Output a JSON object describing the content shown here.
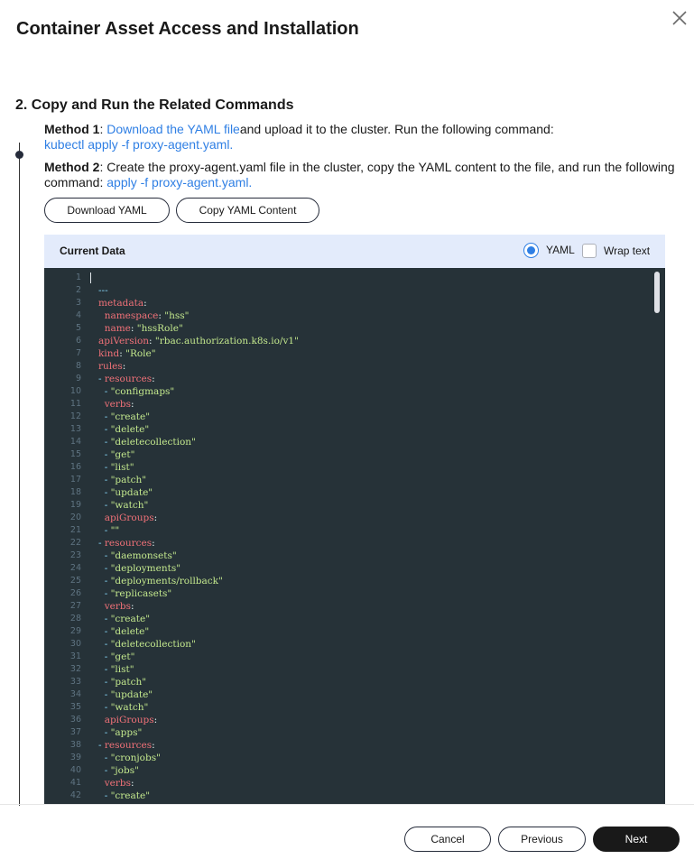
{
  "dialog": {
    "title": "Container Asset Access and Installation",
    "close_icon": "close-icon"
  },
  "section": {
    "title": "2. Copy and Run the Related Commands"
  },
  "method1": {
    "label": "Method 1",
    "sep": ": ",
    "link": "Download the YAML file",
    "text": "and upload it to the cluster. Run the following command:",
    "command": "kubectl apply -f proxy-agent.yaml."
  },
  "method2": {
    "label": "Method 2",
    "text": ": Create the proxy-agent.yaml file in the cluster, copy the YAML content to the file, and run the following command: ",
    "command": "apply -f proxy-agent.yaml."
  },
  "buttons": {
    "download_yaml": "Download YAML",
    "copy_yaml": "Copy YAML Content"
  },
  "data_panel": {
    "title": "Current Data",
    "radio_label": "YAML",
    "radio_selected": true,
    "checkbox_label": "Wrap text",
    "checkbox_checked": false
  },
  "code_lines": [
    [
      [
        "p",
        ""
      ]
    ],
    [
      [
        "d",
        "---"
      ]
    ],
    [
      [
        "k",
        "metadata"
      ],
      [
        "p",
        ":"
      ]
    ],
    [
      [
        "p",
        "  "
      ],
      [
        "k",
        "namespace"
      ],
      [
        "p",
        ": "
      ],
      [
        "s",
        "\"hss\""
      ]
    ],
    [
      [
        "p",
        "  "
      ],
      [
        "k",
        "name"
      ],
      [
        "p",
        ": "
      ],
      [
        "s",
        "\"hssRole\""
      ]
    ],
    [
      [
        "k",
        "apiVersion"
      ],
      [
        "p",
        ": "
      ],
      [
        "s",
        "\"rbac.authorization.k8s.io/v1\""
      ]
    ],
    [
      [
        "k",
        "kind"
      ],
      [
        "p",
        ": "
      ],
      [
        "s",
        "\"Role\""
      ]
    ],
    [
      [
        "k",
        "rules"
      ],
      [
        "p",
        ":"
      ]
    ],
    [
      [
        "d",
        "- "
      ],
      [
        "k",
        "resources"
      ],
      [
        "p",
        ":"
      ]
    ],
    [
      [
        "p",
        "  "
      ],
      [
        "d",
        "- "
      ],
      [
        "s",
        "\"configmaps\""
      ]
    ],
    [
      [
        "p",
        "  "
      ],
      [
        "k",
        "verbs"
      ],
      [
        "p",
        ":"
      ]
    ],
    [
      [
        "p",
        "  "
      ],
      [
        "d",
        "- "
      ],
      [
        "s",
        "\"create\""
      ]
    ],
    [
      [
        "p",
        "  "
      ],
      [
        "d",
        "- "
      ],
      [
        "s",
        "\"delete\""
      ]
    ],
    [
      [
        "p",
        "  "
      ],
      [
        "d",
        "- "
      ],
      [
        "s",
        "\"deletecollection\""
      ]
    ],
    [
      [
        "p",
        "  "
      ],
      [
        "d",
        "- "
      ],
      [
        "s",
        "\"get\""
      ]
    ],
    [
      [
        "p",
        "  "
      ],
      [
        "d",
        "- "
      ],
      [
        "s",
        "\"list\""
      ]
    ],
    [
      [
        "p",
        "  "
      ],
      [
        "d",
        "- "
      ],
      [
        "s",
        "\"patch\""
      ]
    ],
    [
      [
        "p",
        "  "
      ],
      [
        "d",
        "- "
      ],
      [
        "s",
        "\"update\""
      ]
    ],
    [
      [
        "p",
        "  "
      ],
      [
        "d",
        "- "
      ],
      [
        "s",
        "\"watch\""
      ]
    ],
    [
      [
        "p",
        "  "
      ],
      [
        "k",
        "apiGroups"
      ],
      [
        "p",
        ":"
      ]
    ],
    [
      [
        "p",
        "  "
      ],
      [
        "d",
        "- "
      ],
      [
        "s",
        "\"\""
      ]
    ],
    [
      [
        "d",
        "- "
      ],
      [
        "k",
        "resources"
      ],
      [
        "p",
        ":"
      ]
    ],
    [
      [
        "p",
        "  "
      ],
      [
        "d",
        "- "
      ],
      [
        "s",
        "\"daemonsets\""
      ]
    ],
    [
      [
        "p",
        "  "
      ],
      [
        "d",
        "- "
      ],
      [
        "s",
        "\"deployments\""
      ]
    ],
    [
      [
        "p",
        "  "
      ],
      [
        "d",
        "- "
      ],
      [
        "s",
        "\"deployments/rollback\""
      ]
    ],
    [
      [
        "p",
        "  "
      ],
      [
        "d",
        "- "
      ],
      [
        "s",
        "\"replicasets\""
      ]
    ],
    [
      [
        "p",
        "  "
      ],
      [
        "k",
        "verbs"
      ],
      [
        "p",
        ":"
      ]
    ],
    [
      [
        "p",
        "  "
      ],
      [
        "d",
        "- "
      ],
      [
        "s",
        "\"create\""
      ]
    ],
    [
      [
        "p",
        "  "
      ],
      [
        "d",
        "- "
      ],
      [
        "s",
        "\"delete\""
      ]
    ],
    [
      [
        "p",
        "  "
      ],
      [
        "d",
        "- "
      ],
      [
        "s",
        "\"deletecollection\""
      ]
    ],
    [
      [
        "p",
        "  "
      ],
      [
        "d",
        "- "
      ],
      [
        "s",
        "\"get\""
      ]
    ],
    [
      [
        "p",
        "  "
      ],
      [
        "d",
        "- "
      ],
      [
        "s",
        "\"list\""
      ]
    ],
    [
      [
        "p",
        "  "
      ],
      [
        "d",
        "- "
      ],
      [
        "s",
        "\"patch\""
      ]
    ],
    [
      [
        "p",
        "  "
      ],
      [
        "d",
        "- "
      ],
      [
        "s",
        "\"update\""
      ]
    ],
    [
      [
        "p",
        "  "
      ],
      [
        "d",
        "- "
      ],
      [
        "s",
        "\"watch\""
      ]
    ],
    [
      [
        "p",
        "  "
      ],
      [
        "k",
        "apiGroups"
      ],
      [
        "p",
        ":"
      ]
    ],
    [
      [
        "p",
        "  "
      ],
      [
        "d",
        "- "
      ],
      [
        "s",
        "\"apps\""
      ]
    ],
    [
      [
        "d",
        "- "
      ],
      [
        "k",
        "resources"
      ],
      [
        "p",
        ":"
      ]
    ],
    [
      [
        "p",
        "  "
      ],
      [
        "d",
        "- "
      ],
      [
        "s",
        "\"cronjobs\""
      ]
    ],
    [
      [
        "p",
        "  "
      ],
      [
        "d",
        "- "
      ],
      [
        "s",
        "\"jobs\""
      ]
    ],
    [
      [
        "p",
        "  "
      ],
      [
        "k",
        "verbs"
      ],
      [
        "p",
        ":"
      ]
    ],
    [
      [
        "p",
        "  "
      ],
      [
        "d",
        "- "
      ],
      [
        "s",
        "\"create\""
      ]
    ],
    [
      [
        "p",
        "  "
      ],
      [
        "d",
        "- "
      ],
      [
        "s",
        "\"\""
      ]
    ]
  ],
  "footer": {
    "cancel": "Cancel",
    "previous": "Previous",
    "next": "Next"
  },
  "colors": {
    "accent": "#2f7fe4",
    "editor_bg": "#263238",
    "panel_header_bg": "#e3ebfb",
    "primary_button": "#191919"
  }
}
